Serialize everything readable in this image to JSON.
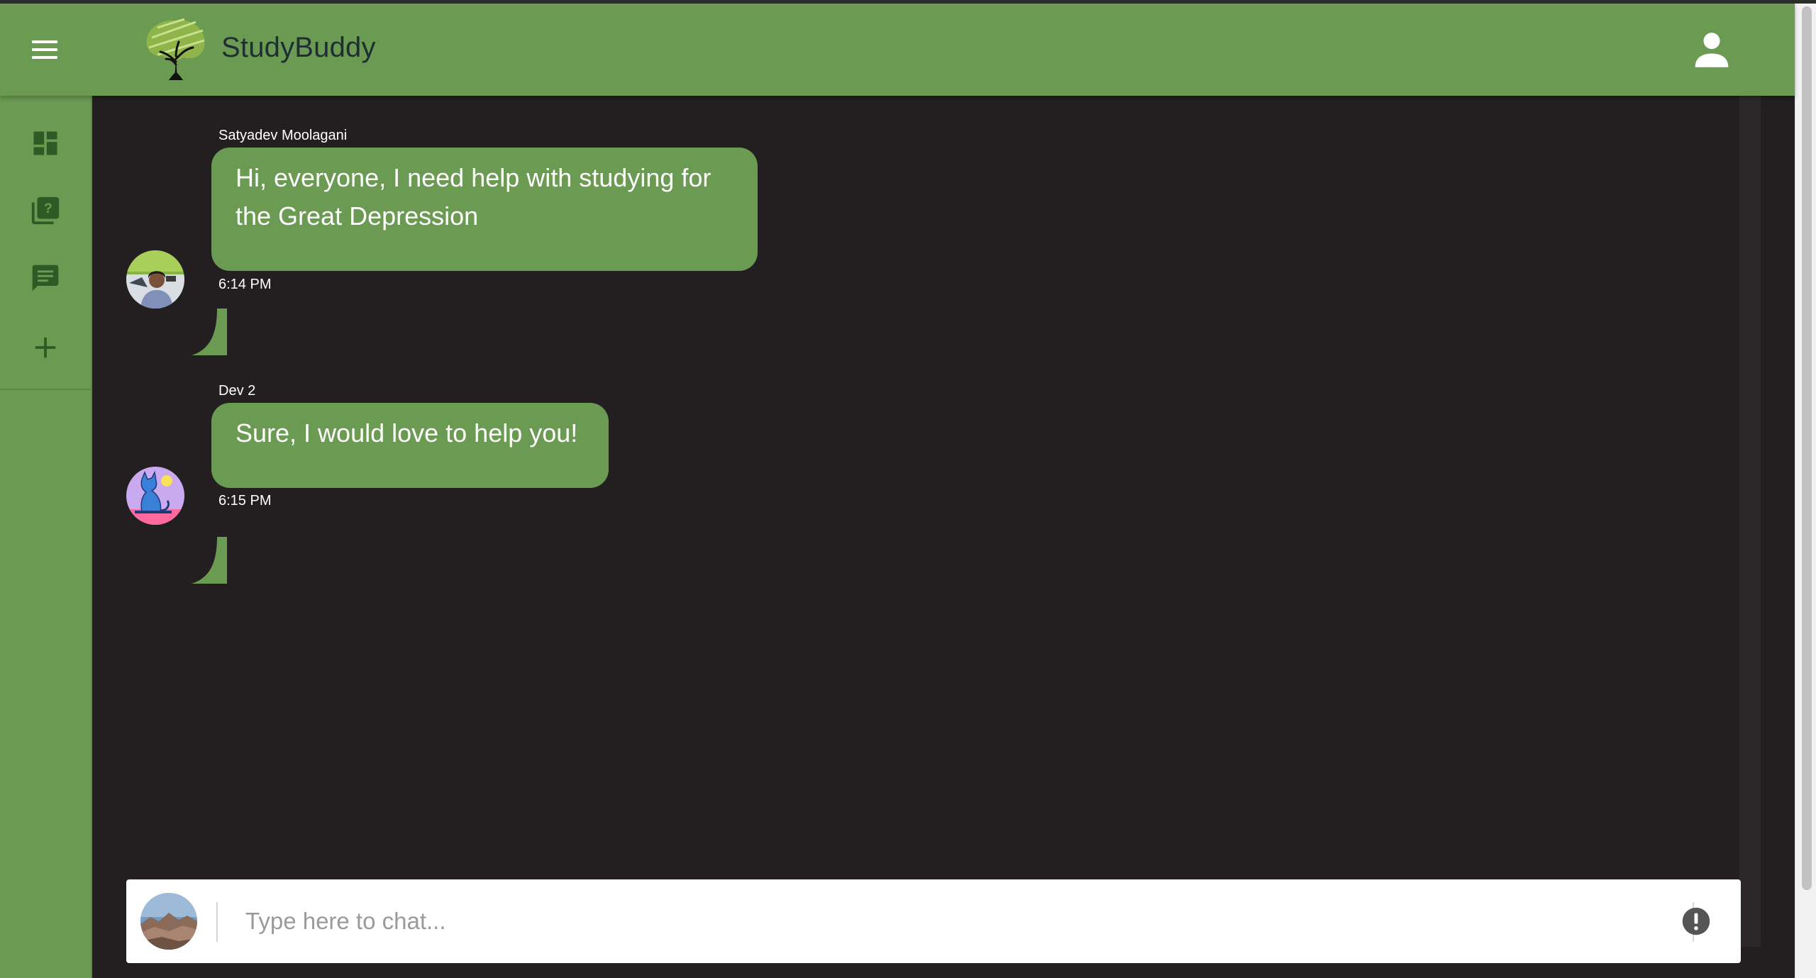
{
  "app": {
    "brand": "StudyBuddy",
    "accent_color": "#6b9a52",
    "background_color": "#231f20"
  },
  "header": {
    "menu_icon": "hamburger-menu-icon",
    "logo_icon": "tree-logo-icon",
    "account_icon": "account-person-icon"
  },
  "sidebar": {
    "items": [
      {
        "icon": "dashboard-icon"
      },
      {
        "icon": "question-library-icon"
      },
      {
        "icon": "chat-message-icon"
      },
      {
        "icon": "add-plus-icon"
      }
    ]
  },
  "messages": [
    {
      "sender": "Satyadev Moolagani",
      "text": "Hi, everyone, I need help with studying for the Great Depression",
      "time": "6:14 PM",
      "avatar": "user-photo-avatar"
    },
    {
      "sender": "Dev 2",
      "text": "Sure, I would love to help you!",
      "time": "6:15 PM",
      "avatar": "cartoon-cat-avatar"
    }
  ],
  "composer": {
    "placeholder": "Type here to chat...",
    "value": "",
    "avatar": "landscape-photo-avatar",
    "alert_icon": "alert-exclamation-icon"
  }
}
